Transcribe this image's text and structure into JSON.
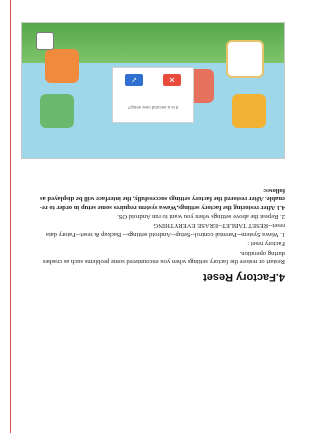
{
  "heading": "4.Factory Reset",
  "body": {
    "intro": "Restart or restore the factory settings when you encountered some problems such as crashes during operation.",
    "factory_reset_label": "Factory reset :",
    "step1": "1. Wawa System--Parental control--Setup--Android settings-- Backup & reset--Fatory data reset--RESET TABLET--ERASE EVERYTHING",
    "step2": "2. Repeat the above settings when you want to run Android OS.",
    "note": "4.1 After restoring the factory settings,Wawa system requires some setup in order to re-enable. After restored the factory settings successfully, the interface will be displayed as follows:"
  },
  "figure": {
    "dialog_message": "It is a second new setup?",
    "confirm_icon": "check-icon",
    "cancel_icon": "close-icon"
  },
  "colors": {
    "margin_line": "#d9534f",
    "confirm": "#2f6fcf",
    "cancel": "#e84b3c"
  }
}
